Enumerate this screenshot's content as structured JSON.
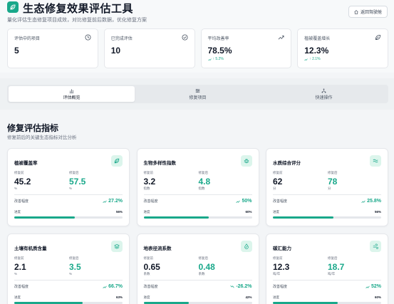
{
  "app": {
    "title": "生态修复效果评估工具",
    "subtitle": "量化评估生态修复项目成效，对比修复前后数据，优化修复方案",
    "back_button": "返回驾驶舱"
  },
  "stats": [
    {
      "label": "评估中的项目",
      "value": "5",
      "trend": "",
      "icon": "clock-icon"
    },
    {
      "label": "已完成评估",
      "value": "10",
      "trend": "",
      "icon": "check-circle-icon"
    },
    {
      "label": "平均改善率",
      "value": "78.5%",
      "trend": "↑ 5.2%",
      "icon": "trend-up-icon"
    },
    {
      "label": "植被覆盖增长",
      "value": "12.3%",
      "trend": "↑ 2.1%",
      "icon": "leaf-icon"
    }
  ],
  "tabs": [
    {
      "label": "评估概览",
      "icon": "bar-chart-icon",
      "active": true
    },
    {
      "label": "修复项目",
      "icon": "sliders-icon",
      "active": false
    },
    {
      "label": "快速操作",
      "icon": "network-icon",
      "active": false
    }
  ],
  "section": {
    "title": "修复评估指标",
    "subtitle": "修复前后的关键生态指标对比分析"
  },
  "labels": {
    "before": "修复前",
    "after": "修复后",
    "improvement": "改善幅度",
    "progress": "进度"
  },
  "metrics": [
    {
      "title": "植被覆盖率",
      "icon": "leaf-icon",
      "before": "45.2",
      "after": "57.5",
      "unit": "%",
      "improvement": "27.2%",
      "progress": 0.56,
      "progress_text": "56%"
    },
    {
      "title": "生物多样性指数",
      "icon": "bug-icon",
      "before": "3.2",
      "after": "4.8",
      "unit": "指数",
      "improvement": "50%",
      "progress": 0.6,
      "progress_text": "60%"
    },
    {
      "title": "水质综合评分",
      "icon": "waves-icon",
      "before": "62",
      "after": "78",
      "unit": "分",
      "improvement": "25.8%",
      "progress": 0.56,
      "progress_text": "56%"
    },
    {
      "title": "土壤有机质含量",
      "icon": "layers-icon",
      "before": "2.1",
      "after": "3.5",
      "unit": "%",
      "improvement": "66.7%",
      "progress": 0.63,
      "progress_text": "63%"
    },
    {
      "title": "地表径流系数",
      "icon": "droplet-icon",
      "before": "0.65",
      "after": "0.48",
      "unit": "系数",
      "improvement": "-26.2%",
      "progress": 0.42,
      "progress_text": "42%"
    },
    {
      "title": "碳汇能力",
      "icon": "wind-icon",
      "before": "12.3",
      "after": "18.7",
      "unit": "吨/年",
      "improvement": "52%",
      "progress": 0.6,
      "progress_text": "60%"
    }
  ],
  "colors": {
    "accent": "#19a88a",
    "accent_light": "#dcf5ec",
    "text": "#111827",
    "muted": "#6b7280"
  }
}
